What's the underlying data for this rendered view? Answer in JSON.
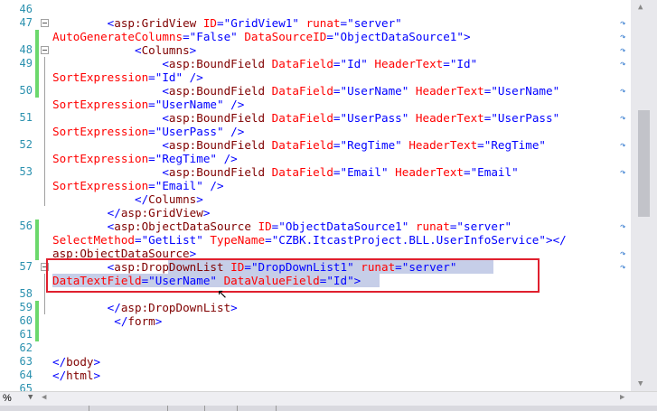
{
  "editor": {
    "line_numbers": [
      "46",
      "47",
      "",
      "48",
      "49",
      "",
      "50",
      "",
      "51",
      "",
      "52",
      "",
      "53",
      "",
      "",
      "",
      "56",
      "",
      "",
      "57",
      "",
      "58",
      "59",
      "60",
      "61",
      "62",
      "63",
      "64",
      "65"
    ],
    "lines": [
      {
        "parts": []
      },
      {
        "parts": [
          {
            "t": "        ",
            "c": ""
          },
          {
            "t": "<",
            "c": "b"
          },
          {
            "t": "asp:GridView",
            "c": "m"
          },
          {
            "t": " ID",
            "c": "r"
          },
          {
            "t": "=",
            "c": "b"
          },
          {
            "t": "\"GridView1\"",
            "c": "s"
          },
          {
            "t": " runat",
            "c": "r"
          },
          {
            "t": "=",
            "c": "b"
          },
          {
            "t": "\"server\"",
            "c": "s"
          }
        ]
      },
      {
        "parts": [
          {
            "t": "AutoGenerateColumns",
            "c": "r"
          },
          {
            "t": "=",
            "c": "b"
          },
          {
            "t": "\"False\"",
            "c": "s"
          },
          {
            "t": " DataSourceID",
            "c": "r"
          },
          {
            "t": "=",
            "c": "b"
          },
          {
            "t": "\"ObjectDataSource1\"",
            "c": "s"
          },
          {
            "t": ">",
            "c": "b"
          }
        ]
      },
      {
        "parts": [
          {
            "t": "            ",
            "c": ""
          },
          {
            "t": "<",
            "c": "b"
          },
          {
            "t": "Columns",
            "c": "m"
          },
          {
            "t": ">",
            "c": "b"
          }
        ]
      },
      {
        "parts": [
          {
            "t": "                ",
            "c": ""
          },
          {
            "t": "<",
            "c": "b"
          },
          {
            "t": "asp:BoundField",
            "c": "m"
          },
          {
            "t": " DataField",
            "c": "r"
          },
          {
            "t": "=",
            "c": "b"
          },
          {
            "t": "\"Id\"",
            "c": "s"
          },
          {
            "t": " HeaderText",
            "c": "r"
          },
          {
            "t": "=",
            "c": "b"
          },
          {
            "t": "\"Id\"",
            "c": "s"
          }
        ]
      },
      {
        "parts": [
          {
            "t": "SortExpression",
            "c": "r"
          },
          {
            "t": "=",
            "c": "b"
          },
          {
            "t": "\"Id\"",
            "c": "s"
          },
          {
            "t": " />",
            "c": "b"
          }
        ]
      },
      {
        "parts": [
          {
            "t": "                ",
            "c": ""
          },
          {
            "t": "<",
            "c": "b"
          },
          {
            "t": "asp:BoundField",
            "c": "m"
          },
          {
            "t": " DataField",
            "c": "r"
          },
          {
            "t": "=",
            "c": "b"
          },
          {
            "t": "\"UserName\"",
            "c": "s"
          },
          {
            "t": " HeaderText",
            "c": "r"
          },
          {
            "t": "=",
            "c": "b"
          },
          {
            "t": "\"UserName\"",
            "c": "s"
          }
        ]
      },
      {
        "parts": [
          {
            "t": "SortExpression",
            "c": "r"
          },
          {
            "t": "=",
            "c": "b"
          },
          {
            "t": "\"UserName\"",
            "c": "s"
          },
          {
            "t": " />",
            "c": "b"
          }
        ]
      },
      {
        "parts": [
          {
            "t": "                ",
            "c": ""
          },
          {
            "t": "<",
            "c": "b"
          },
          {
            "t": "asp:BoundField",
            "c": "m"
          },
          {
            "t": " DataField",
            "c": "r"
          },
          {
            "t": "=",
            "c": "b"
          },
          {
            "t": "\"UserPass\"",
            "c": "s"
          },
          {
            "t": " HeaderText",
            "c": "r"
          },
          {
            "t": "=",
            "c": "b"
          },
          {
            "t": "\"UserPass\"",
            "c": "s"
          }
        ]
      },
      {
        "parts": [
          {
            "t": "SortExpression",
            "c": "r"
          },
          {
            "t": "=",
            "c": "b"
          },
          {
            "t": "\"UserPass\"",
            "c": "s"
          },
          {
            "t": " />",
            "c": "b"
          }
        ]
      },
      {
        "parts": [
          {
            "t": "                ",
            "c": ""
          },
          {
            "t": "<",
            "c": "b"
          },
          {
            "t": "asp:BoundField",
            "c": "m"
          },
          {
            "t": " DataField",
            "c": "r"
          },
          {
            "t": "=",
            "c": "b"
          },
          {
            "t": "\"RegTime\"",
            "c": "s"
          },
          {
            "t": " HeaderText",
            "c": "r"
          },
          {
            "t": "=",
            "c": "b"
          },
          {
            "t": "\"RegTime\"",
            "c": "s"
          }
        ]
      },
      {
        "parts": [
          {
            "t": "SortExpression",
            "c": "r"
          },
          {
            "t": "=",
            "c": "b"
          },
          {
            "t": "\"RegTime\"",
            "c": "s"
          },
          {
            "t": " />",
            "c": "b"
          }
        ]
      },
      {
        "parts": [
          {
            "t": "                ",
            "c": ""
          },
          {
            "t": "<",
            "c": "b"
          },
          {
            "t": "asp:BoundField",
            "c": "m"
          },
          {
            "t": " DataField",
            "c": "r"
          },
          {
            "t": "=",
            "c": "b"
          },
          {
            "t": "\"Email\"",
            "c": "s"
          },
          {
            "t": " HeaderText",
            "c": "r"
          },
          {
            "t": "=",
            "c": "b"
          },
          {
            "t": "\"Email\"",
            "c": "s"
          }
        ]
      },
      {
        "parts": [
          {
            "t": "SortExpression",
            "c": "r"
          },
          {
            "t": "=",
            "c": "b"
          },
          {
            "t": "\"Email\"",
            "c": "s"
          },
          {
            "t": " />",
            "c": "b"
          }
        ]
      },
      {
        "parts": [
          {
            "t": "            ",
            "c": ""
          },
          {
            "t": "</",
            "c": "b"
          },
          {
            "t": "Columns",
            "c": "m"
          },
          {
            "t": ">",
            "c": "b"
          }
        ]
      },
      {
        "parts": [
          {
            "t": "        ",
            "c": ""
          },
          {
            "t": "</",
            "c": "b"
          },
          {
            "t": "asp:GridView",
            "c": "m"
          },
          {
            "t": ">",
            "c": "b"
          }
        ]
      },
      {
        "parts": [
          {
            "t": "        ",
            "c": ""
          },
          {
            "t": "<",
            "c": "b"
          },
          {
            "t": "asp:ObjectDataSource",
            "c": "m"
          },
          {
            "t": " ID",
            "c": "r"
          },
          {
            "t": "=",
            "c": "b"
          },
          {
            "t": "\"ObjectDataSource1\"",
            "c": "s"
          },
          {
            "t": " runat",
            "c": "r"
          },
          {
            "t": "=",
            "c": "b"
          },
          {
            "t": "\"server\"",
            "c": "s"
          }
        ]
      },
      {
        "parts": [
          {
            "t": "SelectMethod",
            "c": "r"
          },
          {
            "t": "=",
            "c": "b"
          },
          {
            "t": "\"GetList\"",
            "c": "s"
          },
          {
            "t": " TypeName",
            "c": "r"
          },
          {
            "t": "=",
            "c": "b"
          },
          {
            "t": "\"CZBK.ItcastProject.BLL.UserInfoService\"",
            "c": "s"
          },
          {
            "t": "></",
            "c": "b"
          }
        ]
      },
      {
        "parts": [
          {
            "t": "asp:ObjectDataSource",
            "c": "m"
          },
          {
            "t": ">",
            "c": "b"
          }
        ]
      },
      {
        "parts": [
          {
            "t": "        ",
            "c": ""
          },
          {
            "t": "<",
            "c": "b"
          },
          {
            "t": "asp:DropDownList",
            "c": "m"
          },
          {
            "t": " ID",
            "c": "r"
          },
          {
            "t": "=",
            "c": "b"
          },
          {
            "t": "\"DropDownList1\"",
            "c": "s"
          },
          {
            "t": " runat",
            "c": "r"
          },
          {
            "t": "=",
            "c": "b"
          },
          {
            "t": "\"server\"",
            "c": "s"
          }
        ]
      },
      {
        "parts": [
          {
            "t": "DataTextField",
            "c": "r"
          },
          {
            "t": "=",
            "c": "b"
          },
          {
            "t": "\"UserName\"",
            "c": "s"
          },
          {
            "t": " DataValueField",
            "c": "r"
          },
          {
            "t": "=",
            "c": "b"
          },
          {
            "t": "\"Id\"",
            "c": "s"
          },
          {
            "t": ">",
            "c": "b"
          }
        ]
      },
      {
        "parts": []
      },
      {
        "parts": [
          {
            "t": "        ",
            "c": ""
          },
          {
            "t": "</",
            "c": "b"
          },
          {
            "t": "asp:DropDownList",
            "c": "m"
          },
          {
            "t": ">",
            "c": "b"
          }
        ]
      },
      {
        "parts": [
          {
            "t": "         ",
            "c": ""
          },
          {
            "t": "</",
            "c": "b"
          },
          {
            "t": "form",
            "c": "m"
          },
          {
            "t": ">",
            "c": "b"
          }
        ]
      },
      {
        "parts": []
      },
      {
        "parts": []
      },
      {
        "parts": [
          {
            "t": "</",
            "c": "b"
          },
          {
            "t": "body",
            "c": "m"
          },
          {
            "t": ">",
            "c": "b"
          }
        ]
      },
      {
        "parts": [
          {
            "t": "</",
            "c": "b"
          },
          {
            "t": "html",
            "c": "m"
          },
          {
            "t": ">",
            "c": "b"
          }
        ]
      },
      {
        "parts": []
      }
    ]
  },
  "status": {
    "zoom": "%"
  }
}
